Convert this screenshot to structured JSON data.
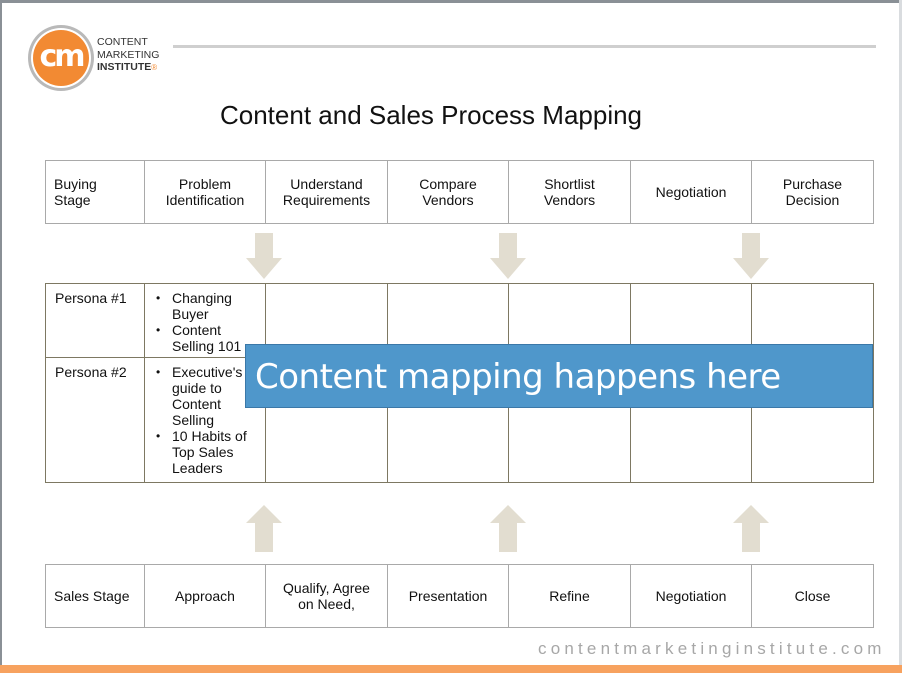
{
  "brand": {
    "logo_glyph": "cm",
    "name_lines": [
      "CONTENT",
      "MARKETING",
      "INSTITUTE"
    ],
    "registered_mark": "®",
    "website": "contentmarketinginstitute.com",
    "colors": {
      "orange": "#f28a33",
      "footer": "#f7a25f",
      "banner_blue": "#4f97cb"
    }
  },
  "title": "Content and Sales Process Mapping",
  "buying_stage": {
    "header": "Buying Stage",
    "stages": [
      "Problem Identification",
      "Understand Requirements",
      "Compare Vendors",
      "Shortlist Vendors",
      "Negotiation",
      "Purchase Decision"
    ]
  },
  "personas": [
    {
      "name": "Persona #1",
      "content": [
        "Changing Buyer",
        "Content Selling 101"
      ]
    },
    {
      "name": "Persona #2",
      "content": [
        "Executive's guide to Content Selling",
        "10 Habits of Top Sales Leaders"
      ]
    }
  ],
  "banner": "Content mapping happens here",
  "sales_stage": {
    "header": "Sales Stage",
    "stages": [
      "Approach",
      "Qualify, Agree on Need,",
      "Presentation",
      "Refine",
      "Negotiation",
      "Close"
    ]
  },
  "arrows": {
    "down_icon": "arrow-down-icon",
    "up_icon": "arrow-up-icon"
  }
}
